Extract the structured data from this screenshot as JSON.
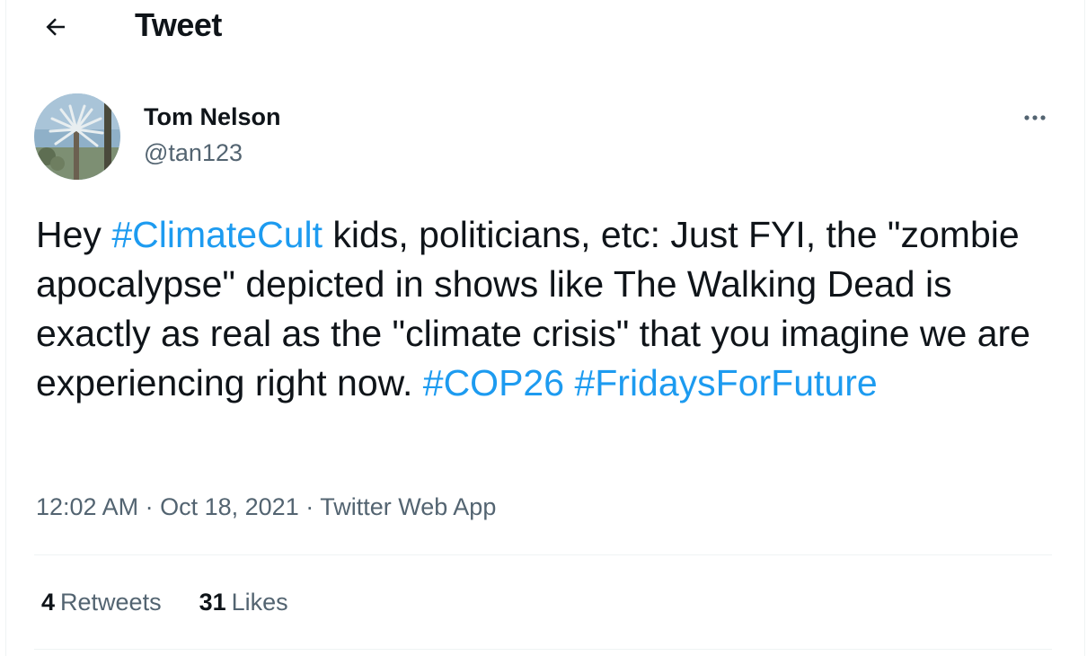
{
  "header": {
    "title": "Tweet",
    "back_icon": "arrow-left-icon"
  },
  "author": {
    "name": "Tom Nelson",
    "handle": "@tan123",
    "avatar_icon": "palm-tree-avatar"
  },
  "more_icon": "more-dots-icon",
  "tweet": {
    "segments": [
      {
        "text": "Hey ",
        "type": "text"
      },
      {
        "text": "#ClimateCult",
        "type": "hashtag"
      },
      {
        "text": " kids, politicians, etc: Just FYI, the \"zombie apocalypse\" depicted in shows like The Walking Dead is exactly as real as the \"climate crisis\" that you imagine we are experiencing right now. ",
        "type": "text"
      },
      {
        "text": "#COP26",
        "type": "hashtag"
      },
      {
        "text": " ",
        "type": "text"
      },
      {
        "text": "#FridaysForFuture",
        "type": "hashtag"
      }
    ]
  },
  "meta": {
    "time": "12:02 AM",
    "separator": "·",
    "date": "Oct 18, 2021",
    "source": "Twitter Web App"
  },
  "stats": {
    "retweets_count": "4",
    "retweets_label": "Retweets",
    "likes_count": "31",
    "likes_label": "Likes"
  },
  "colors": {
    "link": "#1d9bf0",
    "secondary_text": "#536471",
    "primary_text": "#0f1419",
    "divider": "#eff3f4"
  }
}
